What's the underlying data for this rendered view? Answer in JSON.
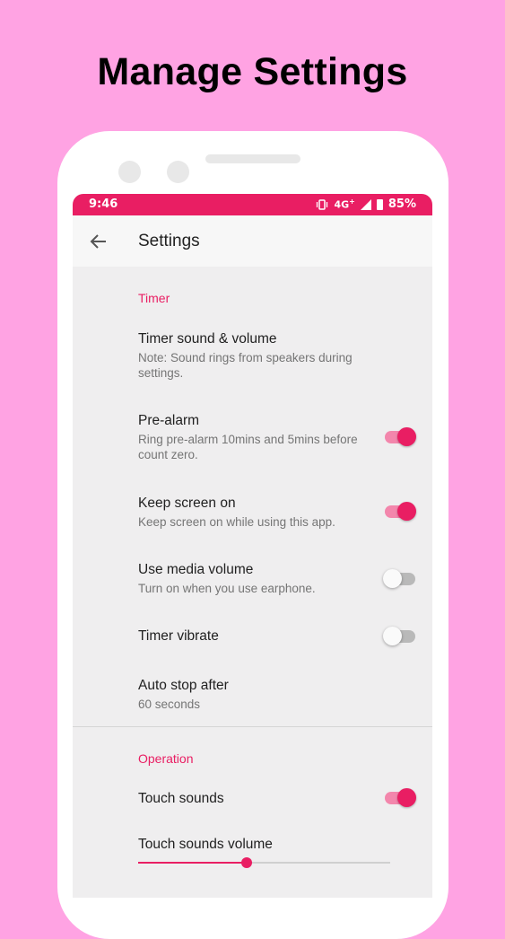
{
  "headline": "Manage Settings",
  "status_bar": {
    "time": "9:46",
    "network": "4G",
    "network_plus": "+",
    "battery": "85%"
  },
  "app_bar": {
    "title": "Settings"
  },
  "sections": {
    "timer": {
      "title": "Timer",
      "items": [
        {
          "title": "Timer sound & volume",
          "subtitle": "Note: Sound rings from speakers during settings."
        },
        {
          "title": "Pre-alarm",
          "subtitle": "Ring pre-alarm 10mins and 5mins before count zero.",
          "switch": true
        },
        {
          "title": "Keep screen on",
          "subtitle": "Keep screen on while using this app.",
          "switch": true
        },
        {
          "title": "Use media volume",
          "subtitle": "Turn on when you use earphone.",
          "switch": false
        },
        {
          "title": "Timer vibrate",
          "switch": false
        },
        {
          "title": "Auto stop after",
          "subtitle": "60 seconds"
        }
      ]
    },
    "operation": {
      "title": "Operation",
      "items": [
        {
          "title": "Touch sounds",
          "switch": true
        },
        {
          "title": "Touch sounds volume",
          "slider_fraction": 0.43
        }
      ]
    }
  },
  "colors": {
    "accent": "#e91e63",
    "background": "#ffa3e3",
    "screen": "#efeeef"
  },
  "icons": {
    "back": "arrow-left-icon",
    "vibrate": "vibrate-icon",
    "signal": "signal-icon",
    "battery": "battery-icon"
  }
}
